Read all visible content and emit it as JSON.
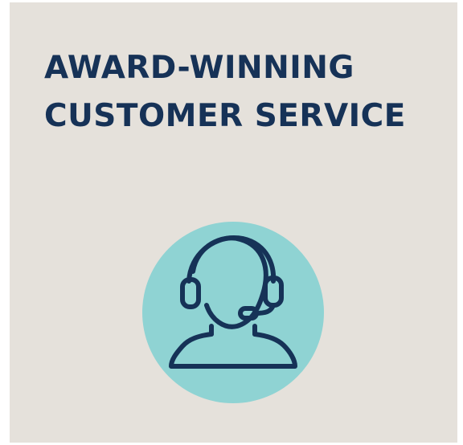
{
  "headline": {
    "line1": "AWARD-WINNING",
    "line2": "CUSTOMER SERVICE"
  },
  "icon": {
    "name": "headset-agent-icon",
    "badge_color": "#8fd3d3",
    "stroke_color": "#163257"
  },
  "colors": {
    "background": "#e5e1db",
    "text": "#163257"
  }
}
